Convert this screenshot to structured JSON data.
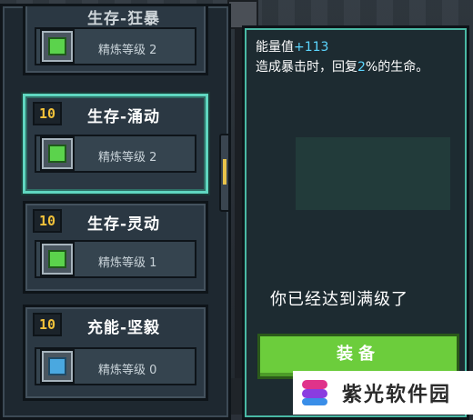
{
  "talent_list": {
    "items": [
      {
        "level": "",
        "name": "生存-狂暴",
        "refine_label": "精炼等级",
        "refine_value": "2",
        "icon": "leaf-talent-icon"
      },
      {
        "level": "10",
        "name": "生存-涌动",
        "refine_label": "精炼等级",
        "refine_value": "2",
        "icon": "shield-talent-icon",
        "selected": true
      },
      {
        "level": "10",
        "name": "生存-灵动",
        "refine_label": "精炼等级",
        "refine_value": "1",
        "icon": "dash-talent-icon"
      },
      {
        "level": "10",
        "name": "充能-坚毅",
        "refine_label": "精炼等级",
        "refine_value": "0",
        "icon": "energy-talent-icon"
      }
    ]
  },
  "detail": {
    "stat_label": "能量值",
    "stat_bonus": "+113",
    "desc_prefix": "造成暴击时，回复",
    "desc_value": "2",
    "desc_suffix": "%的生命。",
    "max_level_text": "你已经达到满级了",
    "equip_label": "装备"
  },
  "watermark": {
    "text": "紫光软件园"
  },
  "colors": {
    "accent": "#5fd6c0",
    "level_badge": "#f2c23a",
    "highlight": "#5cd6ff",
    "equip_button": "#6ccd3c"
  }
}
